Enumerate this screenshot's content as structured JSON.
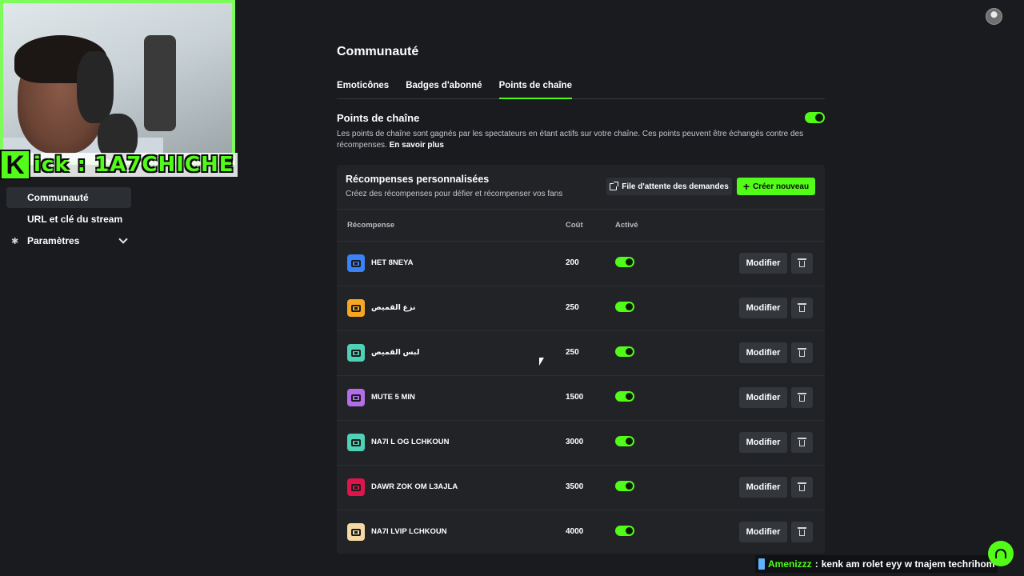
{
  "stream": {
    "kick_letter": "K",
    "tag": "ick : 1A7CHICHE"
  },
  "sidebar": {
    "items": [
      {
        "label": "Communauté"
      },
      {
        "label": "URL et clé du stream"
      },
      {
        "label": "Paramètres"
      }
    ]
  },
  "page": {
    "title": "Communauté"
  },
  "tabs": [
    {
      "label": "Emoticônes"
    },
    {
      "label": "Badges d'abonné"
    },
    {
      "label": "Points de chaîne"
    }
  ],
  "section": {
    "title": "Points de chaîne",
    "description": "Les points de chaîne sont gagnés par les spectateurs en étant actifs sur votre chaîne. Ces points peuvent être échangés contre des récompenses.",
    "learn_more": "En savoir plus",
    "enabled": true
  },
  "rewards": {
    "title": "Récompenses personnalisées",
    "subtitle": "Créez des récompenses pour défier et récompenser vos fans",
    "queue_button": "File d'attente des demandes",
    "create_button": "Créer nouveau",
    "columns": {
      "reward": "Récompense",
      "cost": "Coût",
      "active": "Activé"
    },
    "edit_label": "Modifier",
    "items": [
      {
        "name": "HET 8NEYA",
        "cost": "200",
        "color": "#3b82f6",
        "active": true
      },
      {
        "name": "نزع القميص",
        "cost": "250",
        "color": "#f5a623",
        "active": true
      },
      {
        "name": "لبس القميص",
        "cost": "250",
        "color": "#4fd1b5",
        "active": true
      },
      {
        "name": "MUTE 5 MIN",
        "cost": "1500",
        "color": "#b26ee8",
        "active": true
      },
      {
        "name": "NA7I L OG LCHKOUN",
        "cost": "3000",
        "color": "#4fd1b5",
        "active": true
      },
      {
        "name": "DAWR ZOK OM L3AJLA",
        "cost": "3500",
        "color": "#e0144c",
        "active": true
      },
      {
        "name": "NA7I LVIP LCHKOUN",
        "cost": "4000",
        "color": "#f3d9a4",
        "active": true
      }
    ]
  },
  "chat": {
    "user": "Amenizzz",
    "separator": ":",
    "message": "kenk am rolet eyy w tnajem techrihom"
  },
  "colors": {
    "accent": "#53fc18",
    "background": "#191b1f",
    "card": "#212327"
  }
}
